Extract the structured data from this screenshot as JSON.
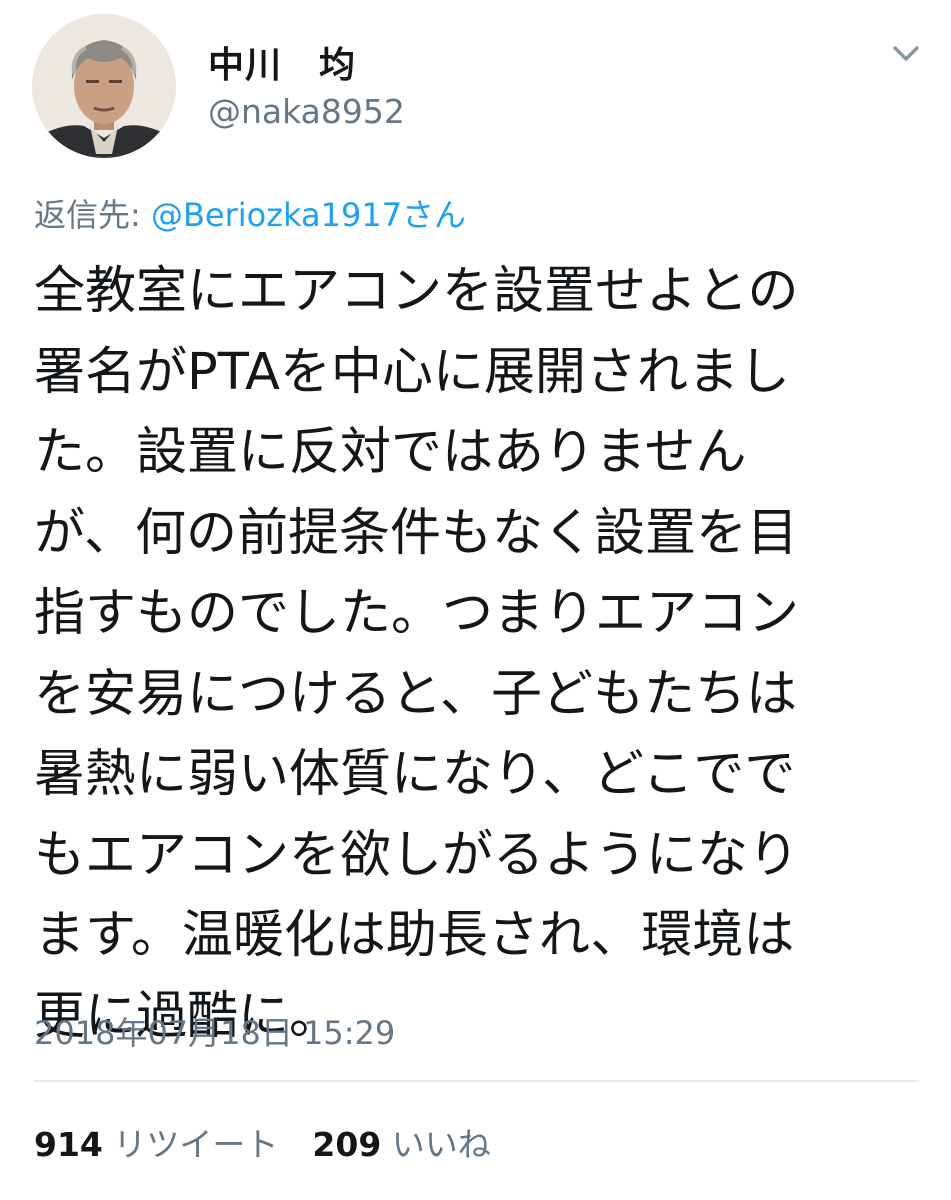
{
  "user": {
    "display_name": "中川　均",
    "handle": "@naka8952",
    "avatar_icon": "profile-photo"
  },
  "menu_icon": "chevron-down-icon",
  "reply": {
    "prefix": "返信先: ",
    "mention": "@Beriozka1917さん"
  },
  "tweet": {
    "lines": [
      "全教室にエアコンを設置せよとの",
      "署名がPTAを中心に展開されまし",
      "た。設置に反対ではありません",
      "が、何の前提条件もなく設置を目",
      "指すものでした。つまりエアコン",
      "を安易につけると、子どもたちは",
      "暑熱に弱い体質になり、どこでで",
      "もエアコンを欲しがるようになり",
      "ます。温暖化は助長され、環境は",
      "更に過酷に。"
    ]
  },
  "timestamp": "2018年07月18日 15:29",
  "stats": {
    "retweets_count": "914",
    "retweets_label": "リツイート",
    "likes_count": "209",
    "likes_label": "いいね"
  },
  "colors": {
    "text": "#14171a",
    "secondary": "#657786",
    "link": "#1da1f2",
    "divider": "#e6ecf0"
  }
}
